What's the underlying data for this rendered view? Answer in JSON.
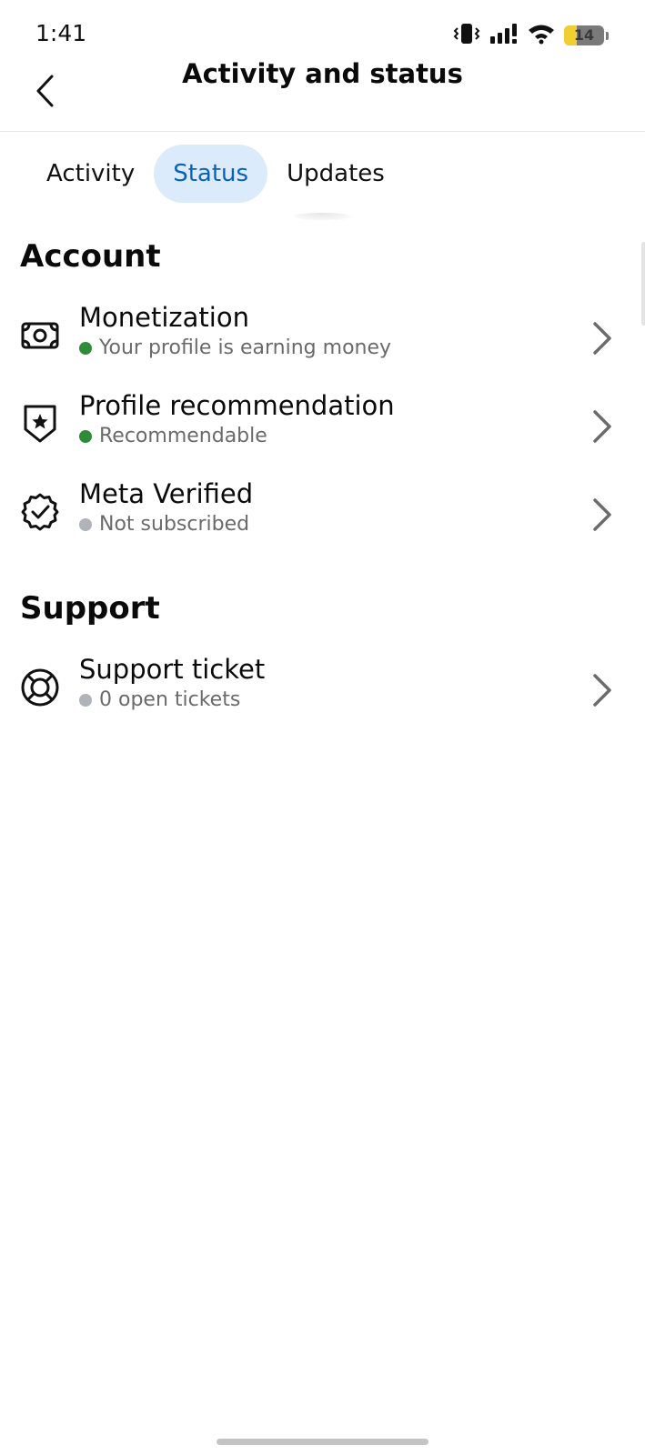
{
  "status_bar": {
    "time": "1:41",
    "battery_level": "14",
    "battery_fraction": 0.14,
    "icons": [
      "vibrate-icon",
      "signal-icon",
      "wifi-icon",
      "battery-icon"
    ]
  },
  "header": {
    "title": "Activity and status",
    "back_icon": "back-arrow-icon"
  },
  "tabs": [
    {
      "label": "Activity",
      "active": false
    },
    {
      "label": "Status",
      "active": true
    },
    {
      "label": "Updates",
      "active": false
    }
  ],
  "sections": {
    "account": {
      "title": "Account",
      "items": [
        {
          "title": "Monetization",
          "subtitle": "Your profile is earning money",
          "status": "active",
          "icon": "money-icon"
        },
        {
          "title": "Profile recommendation",
          "subtitle": "Recommendable",
          "status": "active",
          "icon": "shield-star-icon"
        },
        {
          "title": "Meta Verified",
          "subtitle": "Not subscribed",
          "status": "inactive",
          "icon": "verified-badge-icon"
        }
      ]
    },
    "support": {
      "title": "Support",
      "items": [
        {
          "title": "Support ticket",
          "subtitle": "0 open tickets",
          "status": "inactive",
          "icon": "lifebuoy-icon"
        }
      ]
    }
  },
  "colors": {
    "status_active": "#2e8b3a",
    "status_inactive": "#b0b3b8",
    "tab_active_bg": "#dcebfb",
    "tab_active_text": "#0a62b8",
    "chevron": "#6b6b6b"
  }
}
